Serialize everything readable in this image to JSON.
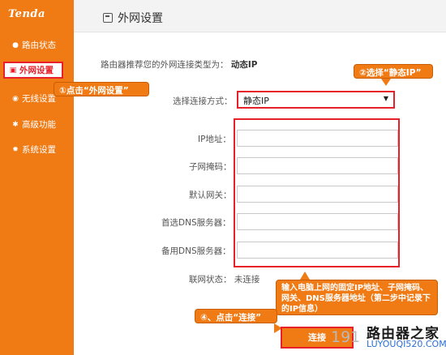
{
  "sidebar": {
    "logo": "Tenda",
    "items": [
      {
        "label": "路由状态",
        "icon": "status-icon"
      },
      {
        "label": "外网设置",
        "icon": "wan-icon"
      },
      {
        "label": "无线设置",
        "icon": "wireless-icon"
      },
      {
        "label": "高级功能",
        "icon": "advanced-icon"
      },
      {
        "label": "系统设置",
        "icon": "system-icon"
      }
    ]
  },
  "header": {
    "title": "外网设置"
  },
  "form": {
    "recommend_label": "路由器推荐您的外网连接类型为：",
    "recommend_value": "动态IP",
    "mode_label": "选择连接方式：",
    "mode_value": "静态IP",
    "fields": [
      {
        "label": "IP地址：",
        "value": ""
      },
      {
        "label": "子网掩码：",
        "value": ""
      },
      {
        "label": "默认网关：",
        "value": ""
      },
      {
        "label": "首选DNS服务器：",
        "value": ""
      },
      {
        "label": "备用DNS服务器：",
        "value": ""
      }
    ],
    "status_label": "联网状态：",
    "status_value": "未连接",
    "connect_button": "连接"
  },
  "callouts": {
    "step1": "①点击“外网设置”",
    "step2": "②选择“静态IP”",
    "step3": "输入电脑上网的固定IP地址、子网掩码、网关、DNS服务器地址（第二步中记录下的IP信息）",
    "step4": "④、点击“连接”"
  },
  "watermark": {
    "partial_number": "191",
    "domain": "路由器之家",
    "url": "LUYOUQI520.COM"
  },
  "colors": {
    "sidebar": "#f07a14",
    "highlight": "#e8202a",
    "callout": "#f07a14"
  }
}
